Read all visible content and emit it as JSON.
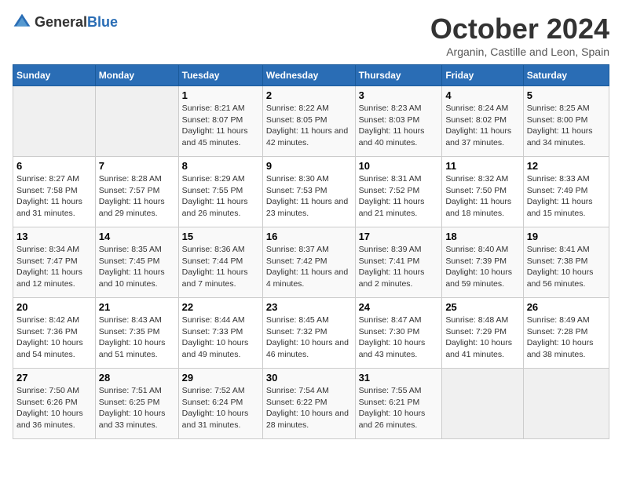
{
  "header": {
    "logo_general": "General",
    "logo_blue": "Blue",
    "month": "October 2024",
    "location": "Arganin, Castille and Leon, Spain"
  },
  "weekdays": [
    "Sunday",
    "Monday",
    "Tuesday",
    "Wednesday",
    "Thursday",
    "Friday",
    "Saturday"
  ],
  "weeks": [
    [
      {
        "day": "",
        "info": ""
      },
      {
        "day": "",
        "info": ""
      },
      {
        "day": "1",
        "info": "Sunrise: 8:21 AM\nSunset: 8:07 PM\nDaylight: 11 hours and 45 minutes."
      },
      {
        "day": "2",
        "info": "Sunrise: 8:22 AM\nSunset: 8:05 PM\nDaylight: 11 hours and 42 minutes."
      },
      {
        "day": "3",
        "info": "Sunrise: 8:23 AM\nSunset: 8:03 PM\nDaylight: 11 hours and 40 minutes."
      },
      {
        "day": "4",
        "info": "Sunrise: 8:24 AM\nSunset: 8:02 PM\nDaylight: 11 hours and 37 minutes."
      },
      {
        "day": "5",
        "info": "Sunrise: 8:25 AM\nSunset: 8:00 PM\nDaylight: 11 hours and 34 minutes."
      }
    ],
    [
      {
        "day": "6",
        "info": "Sunrise: 8:27 AM\nSunset: 7:58 PM\nDaylight: 11 hours and 31 minutes."
      },
      {
        "day": "7",
        "info": "Sunrise: 8:28 AM\nSunset: 7:57 PM\nDaylight: 11 hours and 29 minutes."
      },
      {
        "day": "8",
        "info": "Sunrise: 8:29 AM\nSunset: 7:55 PM\nDaylight: 11 hours and 26 minutes."
      },
      {
        "day": "9",
        "info": "Sunrise: 8:30 AM\nSunset: 7:53 PM\nDaylight: 11 hours and 23 minutes."
      },
      {
        "day": "10",
        "info": "Sunrise: 8:31 AM\nSunset: 7:52 PM\nDaylight: 11 hours and 21 minutes."
      },
      {
        "day": "11",
        "info": "Sunrise: 8:32 AM\nSunset: 7:50 PM\nDaylight: 11 hours and 18 minutes."
      },
      {
        "day": "12",
        "info": "Sunrise: 8:33 AM\nSunset: 7:49 PM\nDaylight: 11 hours and 15 minutes."
      }
    ],
    [
      {
        "day": "13",
        "info": "Sunrise: 8:34 AM\nSunset: 7:47 PM\nDaylight: 11 hours and 12 minutes."
      },
      {
        "day": "14",
        "info": "Sunrise: 8:35 AM\nSunset: 7:45 PM\nDaylight: 11 hours and 10 minutes."
      },
      {
        "day": "15",
        "info": "Sunrise: 8:36 AM\nSunset: 7:44 PM\nDaylight: 11 hours and 7 minutes."
      },
      {
        "day": "16",
        "info": "Sunrise: 8:37 AM\nSunset: 7:42 PM\nDaylight: 11 hours and 4 minutes."
      },
      {
        "day": "17",
        "info": "Sunrise: 8:39 AM\nSunset: 7:41 PM\nDaylight: 11 hours and 2 minutes."
      },
      {
        "day": "18",
        "info": "Sunrise: 8:40 AM\nSunset: 7:39 PM\nDaylight: 10 hours and 59 minutes."
      },
      {
        "day": "19",
        "info": "Sunrise: 8:41 AM\nSunset: 7:38 PM\nDaylight: 10 hours and 56 minutes."
      }
    ],
    [
      {
        "day": "20",
        "info": "Sunrise: 8:42 AM\nSunset: 7:36 PM\nDaylight: 10 hours and 54 minutes."
      },
      {
        "day": "21",
        "info": "Sunrise: 8:43 AM\nSunset: 7:35 PM\nDaylight: 10 hours and 51 minutes."
      },
      {
        "day": "22",
        "info": "Sunrise: 8:44 AM\nSunset: 7:33 PM\nDaylight: 10 hours and 49 minutes."
      },
      {
        "day": "23",
        "info": "Sunrise: 8:45 AM\nSunset: 7:32 PM\nDaylight: 10 hours and 46 minutes."
      },
      {
        "day": "24",
        "info": "Sunrise: 8:47 AM\nSunset: 7:30 PM\nDaylight: 10 hours and 43 minutes."
      },
      {
        "day": "25",
        "info": "Sunrise: 8:48 AM\nSunset: 7:29 PM\nDaylight: 10 hours and 41 minutes."
      },
      {
        "day": "26",
        "info": "Sunrise: 8:49 AM\nSunset: 7:28 PM\nDaylight: 10 hours and 38 minutes."
      }
    ],
    [
      {
        "day": "27",
        "info": "Sunrise: 7:50 AM\nSunset: 6:26 PM\nDaylight: 10 hours and 36 minutes."
      },
      {
        "day": "28",
        "info": "Sunrise: 7:51 AM\nSunset: 6:25 PM\nDaylight: 10 hours and 33 minutes."
      },
      {
        "day": "29",
        "info": "Sunrise: 7:52 AM\nSunset: 6:24 PM\nDaylight: 10 hours and 31 minutes."
      },
      {
        "day": "30",
        "info": "Sunrise: 7:54 AM\nSunset: 6:22 PM\nDaylight: 10 hours and 28 minutes."
      },
      {
        "day": "31",
        "info": "Sunrise: 7:55 AM\nSunset: 6:21 PM\nDaylight: 10 hours and 26 minutes."
      },
      {
        "day": "",
        "info": ""
      },
      {
        "day": "",
        "info": ""
      }
    ]
  ]
}
